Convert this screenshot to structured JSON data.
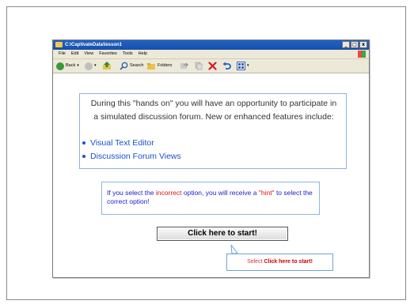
{
  "window": {
    "title": "C:\\CaptivateData\\lesson1",
    "controls": [
      "_",
      "□",
      "x"
    ]
  },
  "menu": [
    "File",
    "Edit",
    "View",
    "Favorites",
    "Tools",
    "Help"
  ],
  "toolbar": {
    "back_label": "Back",
    "search_label": "Search",
    "folders_label": "Folders"
  },
  "intro": {
    "text": "During this \"hands on\" you will have an opportunity to participate in a simulated discussion forum. New or enhanced features include:",
    "features": [
      "Visual Text Editor",
      "Discussion Forum Views"
    ]
  },
  "hint": {
    "part1": "If you select the ",
    "incorrect_word": "incorrect",
    "part2": " option, you will receive a ",
    "hint_word": "\"hint\"",
    "part3": " to select the correct option!"
  },
  "start_button": {
    "label": "Click here to start!"
  },
  "callout": {
    "prefix": "Select ",
    "strong": "Click here to start!"
  },
  "colors": {
    "titlebar": "#1f62c6",
    "link": "#1a4fcf",
    "accent_red": "#e01010",
    "box_border": "#8fb3df"
  }
}
